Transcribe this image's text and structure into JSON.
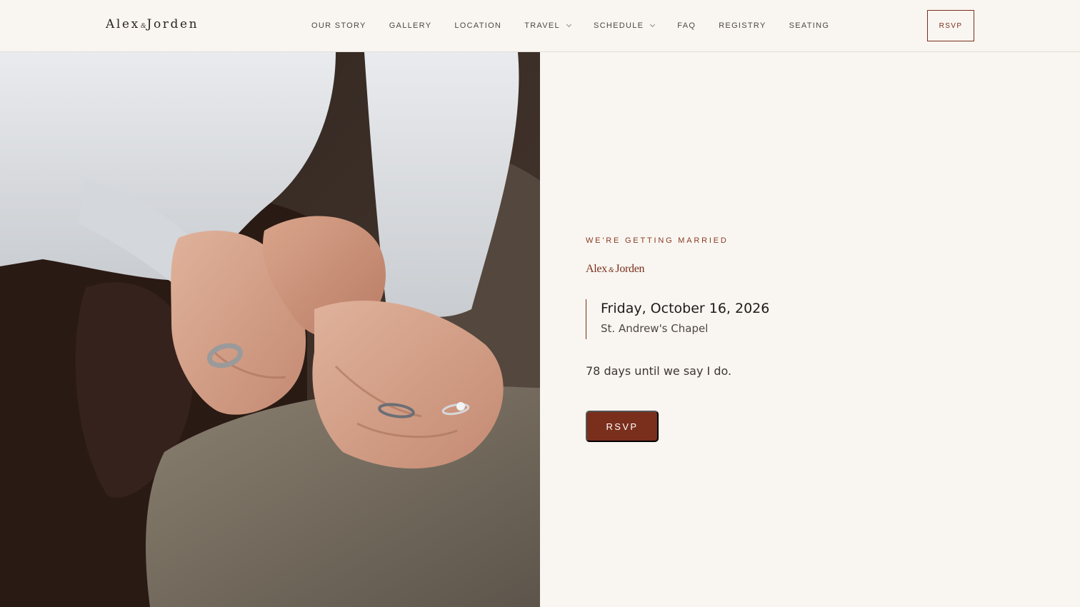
{
  "header": {
    "logo": {
      "first": "Alex",
      "amp": "&",
      "second": "Jorden"
    },
    "nav": [
      {
        "label": "OUR STORY",
        "has_dropdown": false
      },
      {
        "label": "GALLERY",
        "has_dropdown": false
      },
      {
        "label": "LOCATION",
        "has_dropdown": false
      },
      {
        "label": "TRAVEL",
        "has_dropdown": true
      },
      {
        "label": "SCHEDULE",
        "has_dropdown": true
      },
      {
        "label": "FAQ",
        "has_dropdown": false
      },
      {
        "label": "REGISTRY",
        "has_dropdown": false
      },
      {
        "label": "SEATING",
        "has_dropdown": false
      }
    ],
    "rsvp_label": "RSVP"
  },
  "hero": {
    "photo_icon": "couple-holding-hands-photo",
    "eyebrow": "WE'RE GETTING MARRIED",
    "names": {
      "first": "Alex",
      "amp": "&",
      "second": "Jorden"
    },
    "date": "Friday, October 16, 2026",
    "venue": "St. Andrew's Chapel",
    "countdown": "78 days until we say I do.",
    "rsvp_label": "RSVP"
  },
  "colors": {
    "accent": "#7a2e1c",
    "background": "#f9f6f1",
    "text": "#2a2420"
  }
}
